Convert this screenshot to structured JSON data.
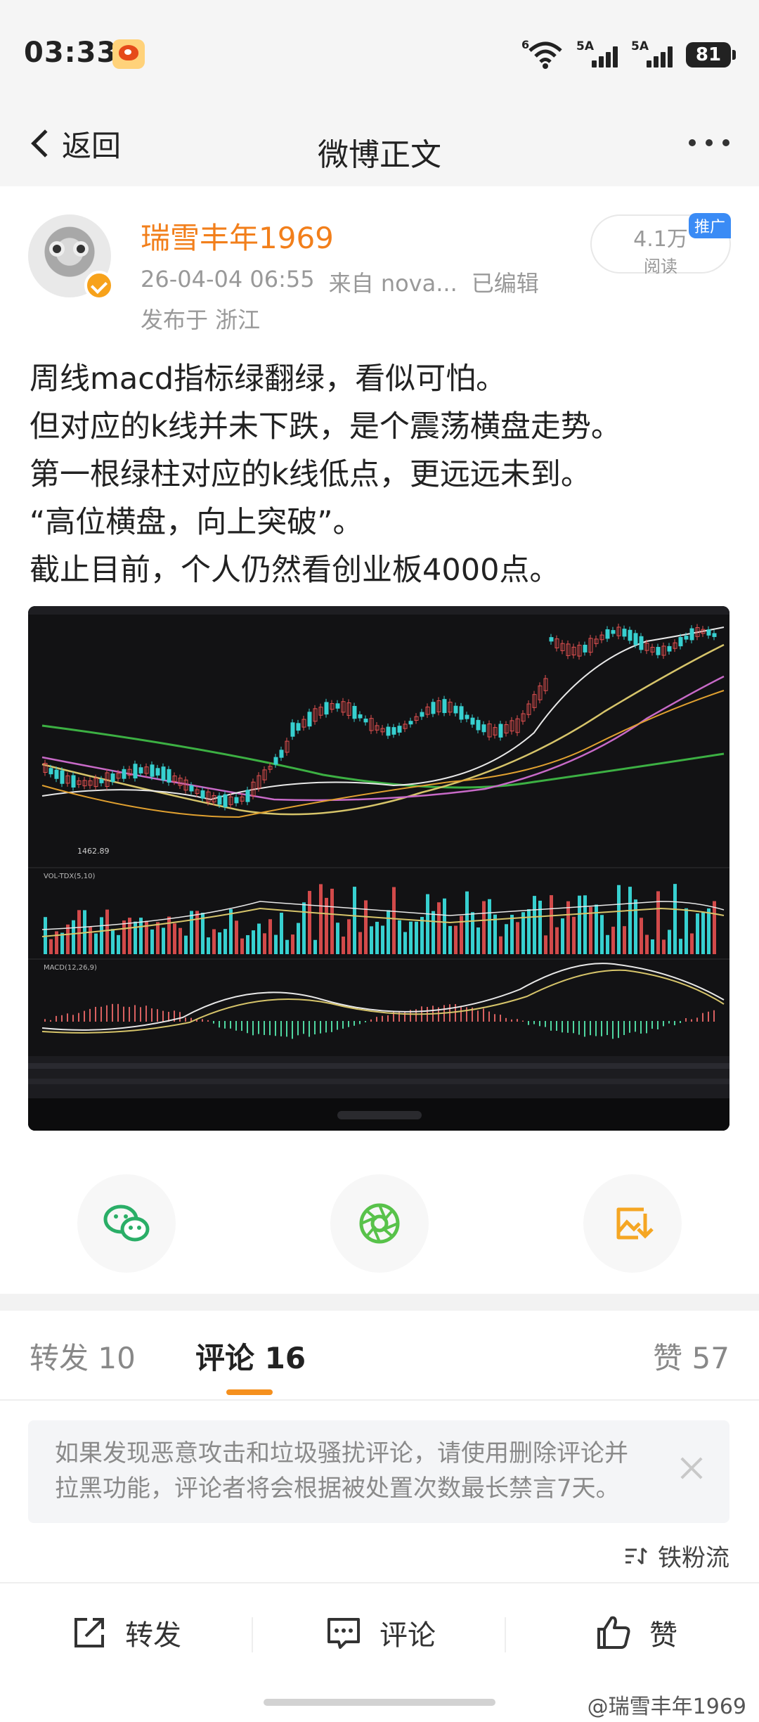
{
  "status_bar": {
    "time": "03:33",
    "network1": "6",
    "network2": "5A",
    "network3": "5A",
    "battery": "81"
  },
  "nav": {
    "back_label": "返回",
    "title": "微博正文"
  },
  "post": {
    "username": "瑞雪丰年1969",
    "date": "26-04-04 06:55",
    "source": "来自 nova...",
    "edited": "已编辑",
    "location": "发布于 浙江",
    "read_count": "4.1万",
    "read_label": "阅读",
    "promo_tag": "推广",
    "text_lines": [
      "周线macd指标绿翻绿，看似可怕。",
      "但对应的k线并未下跌，是个震荡横盘走势。",
      "第一根绿柱对应的k线低点，更远远未到。",
      "“高位横盘，向上突破”。",
      "截止目前，个人仍然看创业板4000点。"
    ],
    "image_caption_low": "1462.89",
    "image_vol_label": "VOL-TDX(5,10)",
    "image_macd_label": "MACD(12,26,9)"
  },
  "share_icons": [
    "wechat-icon",
    "moments-icon",
    "save-image-icon"
  ],
  "tabs": {
    "repost_label": "转发",
    "repost_count": "10",
    "comment_label": "评论",
    "comment_count": "16",
    "like_label": "赞",
    "like_count": "57"
  },
  "notice": {
    "line1": "如果发现恶意攻击和垃圾骚扰评论，请使用删除评论并",
    "line2": "拉黑功能，评论者将会根据被处置次数最长禁言7天。"
  },
  "sort_label": "铁粉流",
  "bottom_bar": {
    "repost": "转发",
    "comment": "评论",
    "like": "赞"
  },
  "watermark": "@瑞雪丰年1969",
  "colors": {
    "username": "#f27f1b",
    "accent": "#f5901e",
    "wechat": "#2aae67",
    "moments": "#58c24a",
    "save": "#f5a623",
    "promo": "#3a8bf5"
  }
}
